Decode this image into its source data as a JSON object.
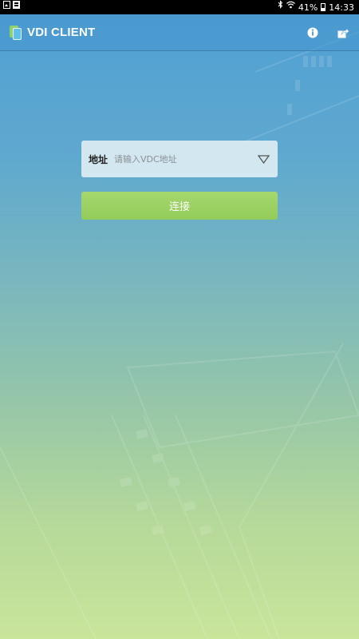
{
  "status_bar": {
    "battery": "41%",
    "time": "14:33",
    "left_icons": [
      "screen-capture-icon",
      "gallery-icon"
    ],
    "right_icons": [
      "bluetooth-icon",
      "wifi-icon",
      "battery-icon"
    ]
  },
  "app_bar": {
    "title": "VDI CLIENT",
    "logo": "vdi-logo-icon",
    "actions": [
      "info-icon",
      "share-icon"
    ]
  },
  "form": {
    "address_label": "地址",
    "address_placeholder": "请输入VDC地址",
    "address_value": "",
    "dropdown_icon": "triangle-down-icon",
    "connect_label": "连接"
  },
  "colors": {
    "top_gradient": "#4f9fd4",
    "bottom_gradient": "#c9e59a",
    "connect_button": "#9bd163",
    "input_bg": "#e8f2f7"
  }
}
